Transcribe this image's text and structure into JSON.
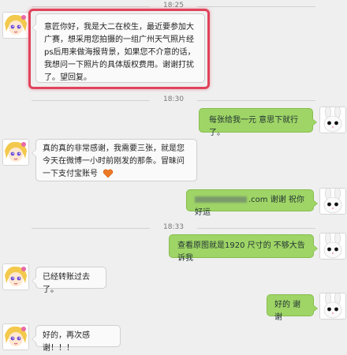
{
  "timestamps": [
    "18:25",
    "18:30",
    "18:33"
  ],
  "messages": [
    {
      "side": "left",
      "text": "意匠你好，我是大二在校生，最近要参加大广赛，想采用您拍摄的一组广州天气照片经ps后用来做海报背景，如果您不介意的话，我想问一下照片的具体版权费用。谢谢打扰了。望回复。"
    },
    {
      "side": "right",
      "text": "每张给我一元 意思下就行了。"
    },
    {
      "side": "left",
      "text": "真的真的非常感谢，我需要三张，就是您今天在微博一小时前刚发的那条。冒昧问一下支付宝账号"
    },
    {
      "side": "right",
      "text_suffix": ".com 谢谢 祝你好运"
    },
    {
      "side": "right",
      "text": "查看原图就是1920 尺寸的 不够大告诉我"
    },
    {
      "side": "left",
      "text": "已经转账过去了。"
    },
    {
      "side": "right",
      "text": "好的 谢谢"
    },
    {
      "side": "left",
      "text": "好的，再次感谢！！！"
    }
  ],
  "colors": {
    "background": "#efefef",
    "bubble_left": "#fafafa",
    "bubble_right": "#9fd566",
    "highlight": "#e0435b"
  },
  "icons": {
    "avatar_left": "anime-girl-avatar",
    "avatar_right": "white-rabbit-avatar",
    "emoji": "heart-icon"
  }
}
